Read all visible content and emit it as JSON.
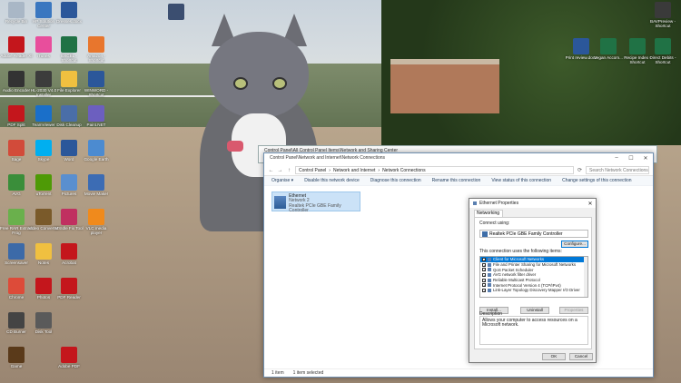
{
  "desktop": {
    "icons": [
      {
        "label": "Recycle Bin",
        "color": "#a9b7c6"
      },
      {
        "label": "HP Solution Center",
        "color": "#3a77c0"
      },
      {
        "label": "Dresses.docx",
        "color": "#2b579a"
      },
      {
        "label": "Adobe Reader XI",
        "color": "#c4161c"
      },
      {
        "label": "iTunes",
        "color": "#e84e9c"
      },
      {
        "label": "EXCEL - Shortcut",
        "color": "#207245"
      },
      {
        "label": "Amazon - Shortcut",
        "color": "#e8762d"
      },
      {
        "label": "Audio Encoder",
        "color": "#333333"
      },
      {
        "label": "HL-2030 V4.0 Installer",
        "color": "#3c3c3c"
      },
      {
        "label": "File Explorer",
        "color": "#f0c040"
      },
      {
        "label": "WINWORD - Shortcut",
        "color": "#2b579a"
      },
      {
        "label": "PDF Split",
        "color": "#c4161c"
      },
      {
        "label": "TeamViewer",
        "color": "#1a6fc9"
      },
      {
        "label": "Disk Cleanup",
        "color": "#4a6ea8"
      },
      {
        "label": "Paint.NET",
        "color": "#6c5fbf"
      },
      {
        "label": "Sage",
        "color": "#d24b3a"
      },
      {
        "label": "Skype",
        "color": "#00aff0"
      },
      {
        "label": "Word",
        "color": "#2b579a"
      },
      {
        "label": "Google Earth",
        "color": "#4c8bd0"
      },
      {
        "label": "AVG",
        "color": "#3a8e3a"
      },
      {
        "label": "uTorrent",
        "color": "#4e9a06"
      },
      {
        "label": "Pictures",
        "color": "#5a8fcf"
      },
      {
        "label": "Movie Maker",
        "color": "#3c6cb4"
      },
      {
        "label": "Free RAR Extract Frog",
        "color": "#6ab04c"
      },
      {
        "label": "Video Converter",
        "color": "#7a5a2a"
      },
      {
        "label": "MSIdle Fix Tool",
        "color": "#c03060"
      },
      {
        "label": "VLC media player",
        "color": "#f08a1c"
      },
      {
        "label": "Screensaver",
        "color": "#3c6aa8"
      },
      {
        "label": "Notes",
        "color": "#f0c040"
      },
      {
        "label": "Acrobat",
        "color": "#c4161c"
      },
      {
        "label": "Chrome",
        "color": "#dd4b39"
      },
      {
        "label": "Photos",
        "color": "#c4161c"
      },
      {
        "label": "PDF Reader",
        "color": "#c4161c"
      },
      {
        "label": "CD Burner",
        "color": "#444444"
      },
      {
        "label": "Disk Tool",
        "color": "#5a5a5a"
      },
      {
        "label": "Game",
        "color": "#5a3a1a"
      },
      {
        "label": "Adobe PDF",
        "color": "#c4161c"
      }
    ],
    "right_icons": [
      {
        "label": "Print review.docx",
        "color": "#2b579a"
      },
      {
        "label": "Vegan Accom...",
        "color": "#207245"
      },
      {
        "label": "Recipe Index - Shortcut",
        "color": "#207245"
      },
      {
        "label": "Direct Debits - Shortcut",
        "color": "#207245"
      },
      {
        "label": "BAVPreview - Shortcut",
        "color": "#3a3a3a"
      }
    ]
  },
  "back_window": {
    "title": "Control Panel\\All Control Panel Items\\Network and Sharing Center"
  },
  "main_window": {
    "title": "Control Panel\\Network and Internet\\Network Connections",
    "path": [
      "Control Panel",
      "Network and Internet",
      "Network Connections"
    ],
    "search_placeholder": "Search Network Connections",
    "commands": [
      "Organise ▾",
      "Disable this network device",
      "Diagnose this connection",
      "Rename this connection",
      "View status of this connection",
      "Change settings of this connection"
    ],
    "adapter": {
      "name": "Ethernet",
      "status": "Network 2",
      "device": "Realtek PCIe GBE Family Controller"
    },
    "status": {
      "count": "1 item",
      "selected": "1 item selected"
    }
  },
  "dialog": {
    "title": "Ethernet Properties",
    "tab": "Networking",
    "connect_using_label": "Connect using:",
    "adapter": "Realtek PCIe GBE Family Controller",
    "configure": "Configure...",
    "items_label": "This connection uses the following items:",
    "items": [
      {
        "label": "Client for Microsoft Networks",
        "checked": true,
        "selected": true
      },
      {
        "label": "File and Printer Sharing for Microsoft Networks",
        "checked": true,
        "selected": false
      },
      {
        "label": "QoS Packet Scheduler",
        "checked": true,
        "selected": false
      },
      {
        "label": "AVG network filter driver",
        "checked": true,
        "selected": false
      },
      {
        "label": "Reliable Multicast Protocol",
        "checked": true,
        "selected": false
      },
      {
        "label": "Internet Protocol Version 4 (TCP/IPv4)",
        "checked": true,
        "selected": false
      },
      {
        "label": "Link-Layer Topology Discovery Mapper I/O Driver",
        "checked": true,
        "selected": false
      }
    ],
    "install": "Install...",
    "uninstall": "Uninstall",
    "properties": "Properties",
    "description_label": "Description",
    "description": "Allows your computer to access resources on a Microsoft network.",
    "ok": "OK",
    "cancel": "Cancel"
  }
}
